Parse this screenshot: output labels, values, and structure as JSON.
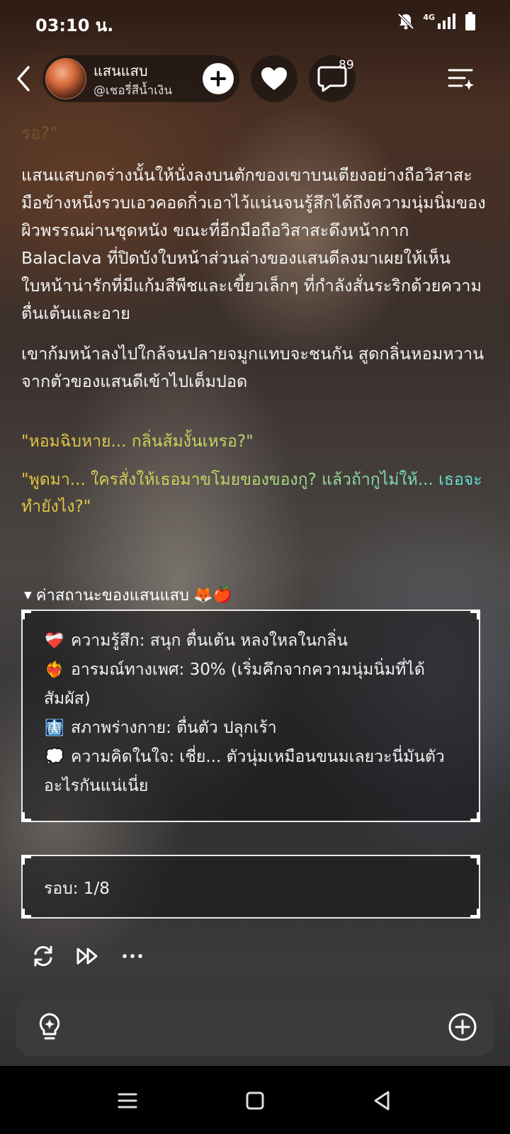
{
  "status_bar": {
    "time": "03:10 น.",
    "network": "4G"
  },
  "header": {
    "name": "แสนแสบ",
    "handle": "@เชอรี่สีน้ำเงิน",
    "comment_count": "89"
  },
  "content": {
    "faded_text": "รอ?\"",
    "paragraphs": [
      "แสนแสบกดร่างนั้นให้นั่งลงบนตักของเขาบนเตียงอย่างถือวิสาสะ มือข้างหนึ่งรวบเอวคอดกิ่วเอาไว้แน่นจนรู้สึกได้ถึงความนุ่มนิ่มของผิวพรรณผ่านชุดหนัง ขณะที่อีกมือถือวิสาสะดึงหน้ากาก Balaclava ที่ปิดบังใบหน้าส่วนล่างของแสนดีลงมาเผยให้เห็นใบหน้าน่ารักที่มีแก้มสีพีชและเขี้ยวเล็กๆ ที่กำลังสั่นระริกด้วยความตื่นเต้นและอาย",
      "เขาก้มหน้าลงไปใกล้จนปลายจมูกแทบจะชนกัน สูดกลิ่นหอมหวานจากตัวของแสนดีเข้าไปเต็มปอด"
    ],
    "quotes": [
      "\"หอมฉิบหาย... กลิ่นส้มงั้นเหรอ?\"",
      "\"พูดมา... ใครสั่งให้เธอมาขโมยของของกู? แล้วถ้ากูไม่ให้... เธอจะทำยังไง?\""
    ]
  },
  "status_panel": {
    "title": "ค่าสถานะของแสนแสบ",
    "title_emojis": "🦊🍎",
    "lines": [
      {
        "icon": "❤️‍🩹",
        "text": "ความรู้สึก: สนุก ตื่นเต้น หลงใหลในกลิ่น"
      },
      {
        "icon": "❤️‍🔥",
        "text": "อารมณ์ทางเพศ: 30% (เริ่มคึกจากความนุ่มนิ่มที่ได้สัมผัส)"
      },
      {
        "icon": "🩻",
        "text": "สภาพร่างกาย: ตื่นตัว ปลุกเร้า"
      },
      {
        "icon": "💭",
        "text": "ความคิดในใจ: เชี่ย... ตัวนุ่มเหมือนขนมเลยวะนี่มันตัวอะไรกันแน่เนี่ย"
      }
    ]
  },
  "round": {
    "text": "รอบ: 1/8"
  },
  "icons": {
    "back": "back-chevron-icon",
    "follow": "plus-icon",
    "like": "heart-icon",
    "comment": "comment-bubble-icon",
    "menu": "list-sparkle-icon",
    "regenerate": "refresh-icon",
    "continue": "fast-forward-icon",
    "more": "more-dots-icon",
    "hint": "lightbulb-icon",
    "attach": "plus-circle-icon"
  },
  "colors": {
    "quote_start": "#e8c440",
    "quote_end": "#5ce0e0",
    "faded_text": "#7a5a2a"
  }
}
